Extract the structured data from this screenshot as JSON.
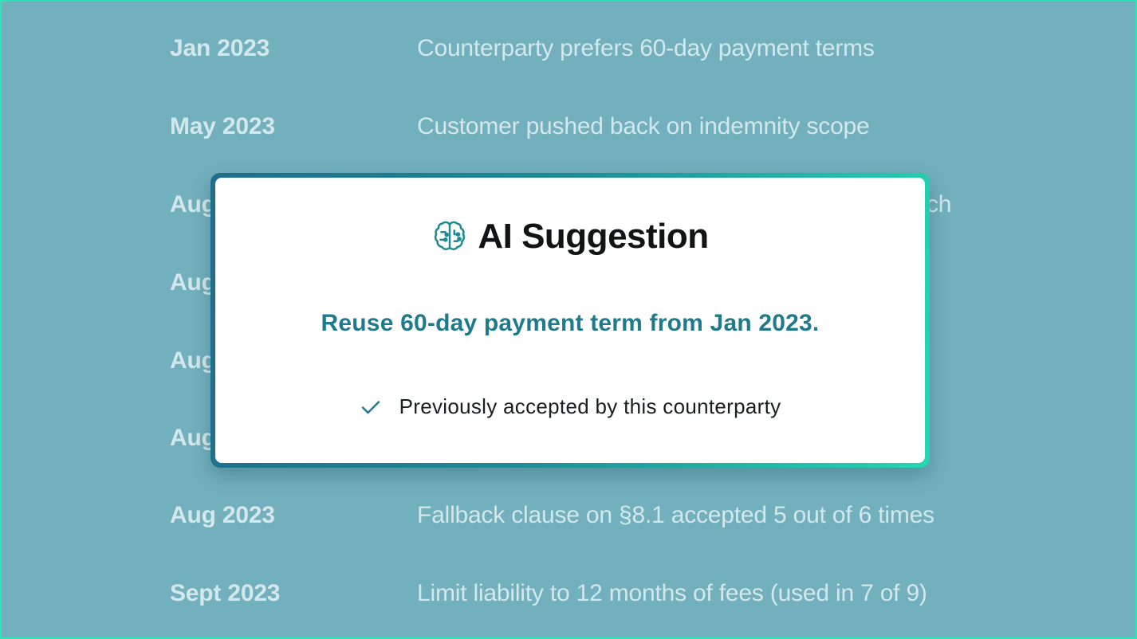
{
  "history": [
    {
      "date": "Jan 2023",
      "note": "Counterparty prefers 60-day payment terms"
    },
    {
      "date": "May 2023",
      "note": "Customer pushed back on indemnity scope"
    },
    {
      "date": "Aug",
      "note": "ch"
    },
    {
      "date": "Aug",
      "note": ""
    },
    {
      "date": "Aug",
      "note": ""
    },
    {
      "date": "Aug",
      "note": ""
    },
    {
      "date": "Aug 2023",
      "note": "Fallback clause on §8.1 accepted 5 out of 6 times"
    },
    {
      "date": "Sept 2023",
      "note": "Limit liability to 12 months of fees (used in 7 of 9)"
    }
  ],
  "modal": {
    "icon": "brain-icon",
    "title": "AI Suggestion",
    "suggestion": "Reuse 60-day payment term from Jan 2023.",
    "reason_icon": "check-icon",
    "reason": "Previously accepted by this counterparty"
  },
  "colors": {
    "background": "#72b0bd",
    "accent": "#1e7a8c",
    "border_gradient_start": "#1f6d8a",
    "border_gradient_end": "#24d7b1"
  }
}
